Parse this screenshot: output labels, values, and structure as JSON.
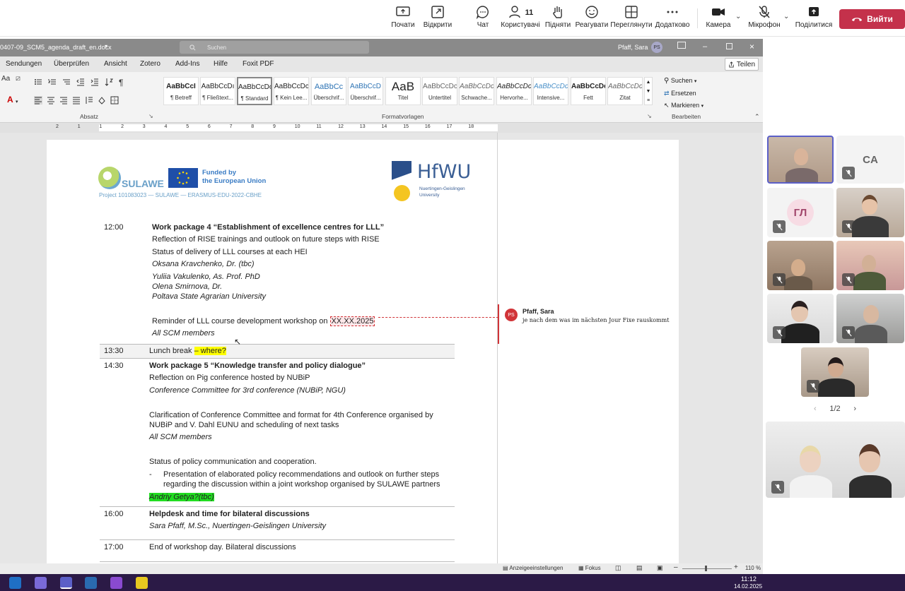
{
  "teams": {
    "buttons": [
      {
        "name": "share-screen-button",
        "label": "Почати"
      },
      {
        "name": "open-button",
        "label": "Відкрити"
      },
      {
        "name": "chat-button",
        "label": "Чат"
      },
      {
        "name": "people-button",
        "label": "Користувачі",
        "count": "11"
      },
      {
        "name": "raise-hand-button",
        "label": "Підняти"
      },
      {
        "name": "react-button",
        "label": "Реагувати"
      },
      {
        "name": "view-button",
        "label": "Переглянути"
      },
      {
        "name": "more-button",
        "label": "Додатково"
      },
      {
        "name": "camera-button",
        "label": "Камера"
      },
      {
        "name": "mic-button",
        "label": "Мікрофон"
      },
      {
        "name": "share-button",
        "label": "Поділитися"
      }
    ],
    "leave_label": "Вийти",
    "leave_color": "#c4314b"
  },
  "word": {
    "filename": "0407-09_SCM5_agenda_draft_en.docx",
    "search_placeholder": "Suchen",
    "user_name": "Pfaff, Sara",
    "user_initials": "PS",
    "tabs": [
      "Sendungen",
      "Überprüfen",
      "Ansicht",
      "Zotero",
      "Add-Ins",
      "Hilfe",
      "Foxit PDF"
    ],
    "share_label": "Teilen",
    "styles": [
      {
        "preview": "AaBbCcI",
        "name": "¶ Betreff"
      },
      {
        "preview": "AaBbCcDı",
        "name": "¶ Fließtext..."
      },
      {
        "preview": "AaBbCcDc",
        "name": "¶ Standard"
      },
      {
        "preview": "AaBbCcDc",
        "name": "¶ Kein Lee..."
      },
      {
        "preview": "AaBbCc",
        "name": "Überschrif..."
      },
      {
        "preview": "AaBbCcD",
        "name": "Überschrif..."
      },
      {
        "preview": "AaB",
        "name": "Titel"
      },
      {
        "preview": "AaBbCcDc",
        "name": "Untertitel"
      },
      {
        "preview": "AaBbCcDc",
        "name": "Schwache..."
      },
      {
        "preview": "AaBbCcDc",
        "name": "Hervorhe..."
      },
      {
        "preview": "AaBbCcDc",
        "name": "Intensive..."
      },
      {
        "preview": "AaBbCcDd",
        "name": "Fett"
      },
      {
        "preview": "AaBbCcDc",
        "name": "Zitat"
      }
    ],
    "group_labels": {
      "absatz": "Absatz",
      "formatvorlagen": "Formatvorlagen",
      "bearbeiten": "Bearbeiten"
    },
    "edit_items": [
      "Suchen",
      "Ersetzen",
      "Markieren"
    ],
    "ruler_numbers": [
      "2",
      "1",
      "1",
      "2",
      "3",
      "4",
      "5",
      "6",
      "7",
      "8",
      "9",
      "10",
      "11",
      "12",
      "13",
      "14",
      "15",
      "16",
      "17",
      "18"
    ],
    "status": {
      "display_settings": "Anzeigeeinstellungen",
      "focus": "Fokus",
      "zoom": "110 %"
    }
  },
  "document": {
    "logo_sulawe": "SULAWE",
    "eu_funded": "Funded by",
    "eu_funded2": "the European Union",
    "project_line": "Project 101083023 — SULAWE — ERASMUS-EDU-2022-CBHE",
    "hfwu": "HfWU",
    "hfwu_sub1": "Nuertingen-Geislingen",
    "hfwu_sub2": "University",
    "t1200": "12:00",
    "wp4_title": "Work package 4 “Establishment of excellence centres for LLL”",
    "wp4_l1": "Reflection of RISE trainings and outlook on future steps with RISE",
    "wp4_l2": "Status of delivery of LLL courses at each HEI",
    "wp4_l3": "Oksana Kravchenko, Dr. (tbc)",
    "wp4_l4": "Yuliia Vakulenko, As. Prof. PhD",
    "wp4_l5": "Olena Smirnova, Dr.",
    "wp4_l6": "Poltava State Agrarian University",
    "wp4_l7a": "Reminder of LLL course development workshop on ",
    "wp4_l7b": "XX.XX.2025",
    "wp4_l8": "All SCM members",
    "t1330": "13:30",
    "lunch_a": "Lunch break ",
    "lunch_b": "– where?",
    "t1430": "14:30",
    "wp5_title": "Work package 5 “Knowledge transfer and policy dialogue”",
    "wp5_l1": "Reflection on Pig conference hosted by NUBiP",
    "wp5_l2": "Conference Committee for 3rd conference (NUBiP, NGU)",
    "wp5_l3": "Clarification of Conference Committee and format for 4th Conference organised by",
    "wp5_l4": "NUBiP and V. Dahl EUNU and scheduling of next tasks",
    "wp5_l5": "All SCM members",
    "wp5_l6": "Status of policy communication and cooperation.",
    "wp5_l7": "Presentation of elaborated policy recommendations and outlook on further steps",
    "wp5_l8": "regarding the discussion within a joint workshop organised by SULAWE partners",
    "wp5_l9": "Andriy Getya?(tbc)",
    "t1600": "16:00",
    "help_title": "Helpdesk and time for bilateral discussions",
    "help_l1": "Sara Pfaff, M.Sc., Nuertingen-Geislingen University",
    "t1700": "17:00",
    "end_l": "End of workshop day. Bilateral discussions"
  },
  "comment": {
    "initials": "PS",
    "author": "Pfaff, Sara",
    "text": "je nach dem was im nächsten Jour Fixe rauskommt"
  },
  "video": {
    "initials_ca": "CA",
    "initials_gl": "ГЛ",
    "page_indicator": "1/2"
  },
  "taskbar": {
    "time": "11:12",
    "date": "14.02.2025"
  }
}
